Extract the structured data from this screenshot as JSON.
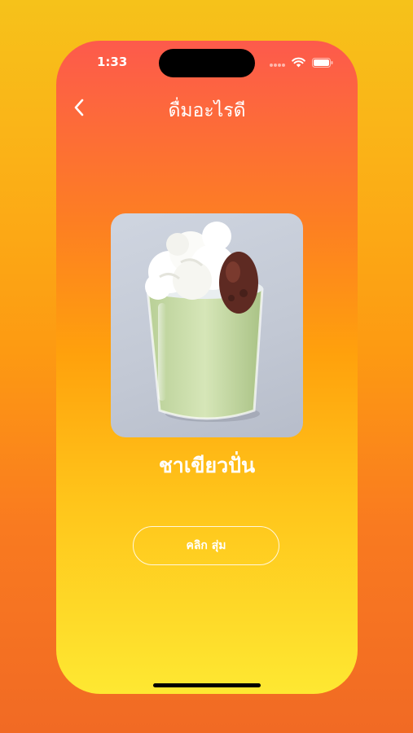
{
  "status_bar": {
    "time": "1:33",
    "icons": [
      "signal-dots-icon",
      "wifi-icon",
      "battery-icon"
    ]
  },
  "nav": {
    "back_icon": "chevron-left-icon",
    "title": "ดื่มอะไรดี"
  },
  "drink": {
    "image_subject": "green tea frappe with whipped cream and red bean",
    "name": "ชาเขียวปั่น"
  },
  "actions": {
    "random_label": "คลิก สุ่ม"
  },
  "colors": {
    "gradient_top": "#fd5a4c",
    "gradient_mid": "#ffa10c",
    "gradient_bottom": "#fee832",
    "text": "#ffffff"
  }
}
